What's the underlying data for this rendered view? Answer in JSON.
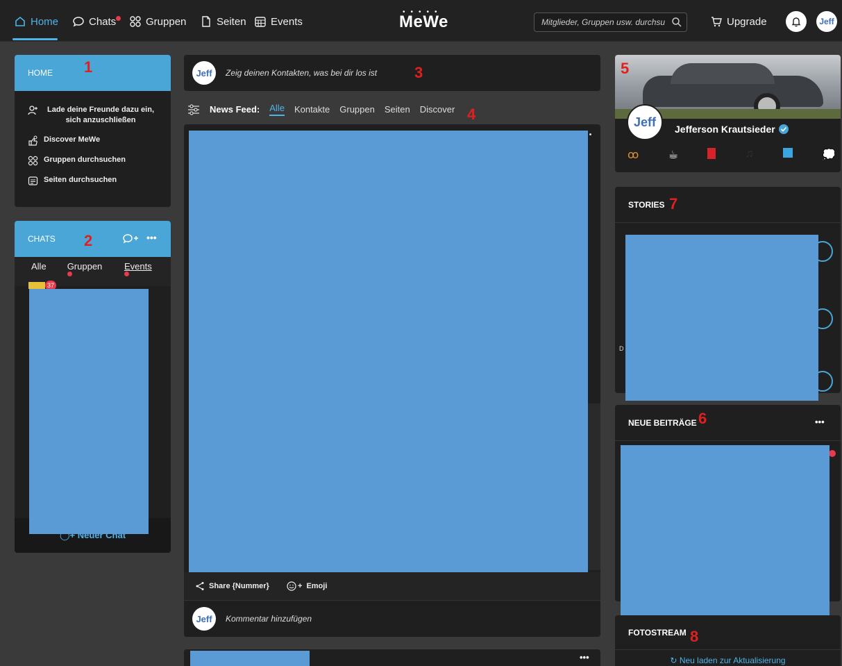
{
  "nav": {
    "home": "Home",
    "chats": "Chats",
    "gruppen": "Gruppen",
    "seiten": "Seiten",
    "events": "Events",
    "logo": "MeWe",
    "search_placeholder": "Mitglieder, Gruppen usw. durchsu",
    "upgrade": "Upgrade",
    "avatar": "Jeff"
  },
  "home_panel": {
    "title": "HOME",
    "items": [
      {
        "label": "Lade deine Freunde dazu ein, sich anzuschließen",
        "icon": "user-plus-icon"
      },
      {
        "label": "Discover MeWe",
        "icon": "discover-icon"
      },
      {
        "label": "Gruppen durchsuchen",
        "icon": "groups-icon"
      },
      {
        "label": "Seiten durchsuchen",
        "icon": "pages-icon"
      }
    ]
  },
  "chats_panel": {
    "title": "CHATS",
    "tabs": [
      "Alle",
      "Gruppen",
      "Events"
    ],
    "badge": "37",
    "new_chat": "Neuer Chat"
  },
  "composer": {
    "avatar": "Jeff",
    "placeholder": "Zeig deinen Kontakten, was bei dir los ist"
  },
  "feed_nav": {
    "label": "News Feed:",
    "tabs": [
      "Alle",
      "Kontakte",
      "Gruppen",
      "Seiten",
      "Discover"
    ]
  },
  "post": {
    "share": "Share {Nummer}",
    "emoji": "Emoji",
    "comment_avatar": "Jeff",
    "comment_placeholder": "Kommentar hinzufügen",
    "more": "•••"
  },
  "profile": {
    "avatar": "Jeff",
    "name": "Jefferson Krautsieder"
  },
  "stories": {
    "title": "STORIES",
    "partial_label": "D"
  },
  "neue_beitraege": {
    "title": "NEUE BEITRÄGE",
    "more": "•••"
  },
  "fotostream": {
    "title": "FOTOSTREAM",
    "reload": "Neu laden zur Aktualisierung"
  },
  "annotations": [
    "1",
    "2",
    "3",
    "4",
    "5",
    "6",
    "7",
    "8"
  ],
  "colors": {
    "accent": "#4fb3e8",
    "panel_header": "#4aa6d6",
    "redaction": "#5b9bd5",
    "annotation": "#e02020",
    "notification": "#e73b4b"
  }
}
